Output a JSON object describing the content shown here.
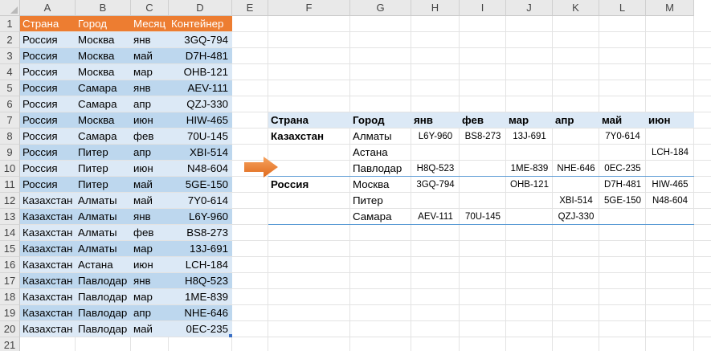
{
  "columns": [
    "A",
    "B",
    "C",
    "D",
    "E",
    "F",
    "G",
    "H",
    "I",
    "J",
    "K",
    "L",
    "M"
  ],
  "rows": [
    1,
    2,
    3,
    4,
    5,
    6,
    7,
    8,
    9,
    10,
    11,
    12,
    13,
    14,
    15,
    16,
    17,
    18,
    19,
    20,
    21
  ],
  "source_table": {
    "headers": [
      "Страна",
      "Город",
      "Месяц",
      "Контейнер"
    ],
    "rows": [
      [
        "Россия",
        "Москва",
        "янв",
        "3GQ-794"
      ],
      [
        "Россия",
        "Москва",
        "май",
        "D7H-481"
      ],
      [
        "Россия",
        "Москва",
        "мар",
        "OHB-121"
      ],
      [
        "Россия",
        "Самара",
        "янв",
        "AEV-111"
      ],
      [
        "Россия",
        "Самара",
        "апр",
        "QZJ-330"
      ],
      [
        "Россия",
        "Москва",
        "июн",
        "HIW-465"
      ],
      [
        "Россия",
        "Самара",
        "фев",
        "70U-145"
      ],
      [
        "Россия",
        "Питер",
        "апр",
        "XBI-514"
      ],
      [
        "Россия",
        "Питер",
        "июн",
        "N48-604"
      ],
      [
        "Россия",
        "Питер",
        "май",
        "5GE-150"
      ],
      [
        "Казахстан",
        "Алматы",
        "май",
        "7Y0-614"
      ],
      [
        "Казахстан",
        "Алматы",
        "янв",
        "L6Y-960"
      ],
      [
        "Казахстан",
        "Алматы",
        "фев",
        "BS8-273"
      ],
      [
        "Казахстан",
        "Алматы",
        "мар",
        "13J-691"
      ],
      [
        "Казахстан",
        "Астана",
        "июн",
        "LCH-184"
      ],
      [
        "Казахстан",
        "Павлодар",
        "янв",
        "H8Q-523"
      ],
      [
        "Казахстан",
        "Павлодар",
        "мар",
        "1ME-839"
      ],
      [
        "Казахстан",
        "Павлодар",
        "апр",
        "NHE-646"
      ],
      [
        "Казахстан",
        "Павлодар",
        "май",
        "0EC-235"
      ]
    ]
  },
  "pivot_table": {
    "headers": [
      "Страна",
      "Город",
      "янв",
      "фев",
      "мар",
      "апр",
      "май",
      "июн"
    ],
    "rows": [
      [
        "Казахстан",
        "Алматы",
        "L6Y-960",
        "BS8-273",
        "13J-691",
        "",
        "7Y0-614",
        ""
      ],
      [
        "",
        "Астана",
        "",
        "",
        "",
        "",
        "",
        "LCH-184"
      ],
      [
        "",
        "Павлодар",
        "H8Q-523",
        "",
        "1ME-839",
        "NHE-646",
        "0EC-235",
        ""
      ],
      [
        "Россия",
        "Москва",
        "3GQ-794",
        "",
        "OHB-121",
        "",
        "D7H-481",
        "HIW-465"
      ],
      [
        "",
        "Питер",
        "",
        "",
        "",
        "XBI-514",
        "5GE-150",
        "N48-604"
      ],
      [
        "",
        "Самара",
        "AEV-111",
        "70U-145",
        "",
        "QZJ-330",
        "",
        ""
      ]
    ]
  },
  "colors": {
    "header_orange": "#ed7d31",
    "band_light": "#dce9f6",
    "band_dark": "#bdd7ee",
    "arrow": "#ed7d31",
    "divider": "#5b9bd5"
  },
  "icons": [
    "right-arrow-icon"
  ]
}
